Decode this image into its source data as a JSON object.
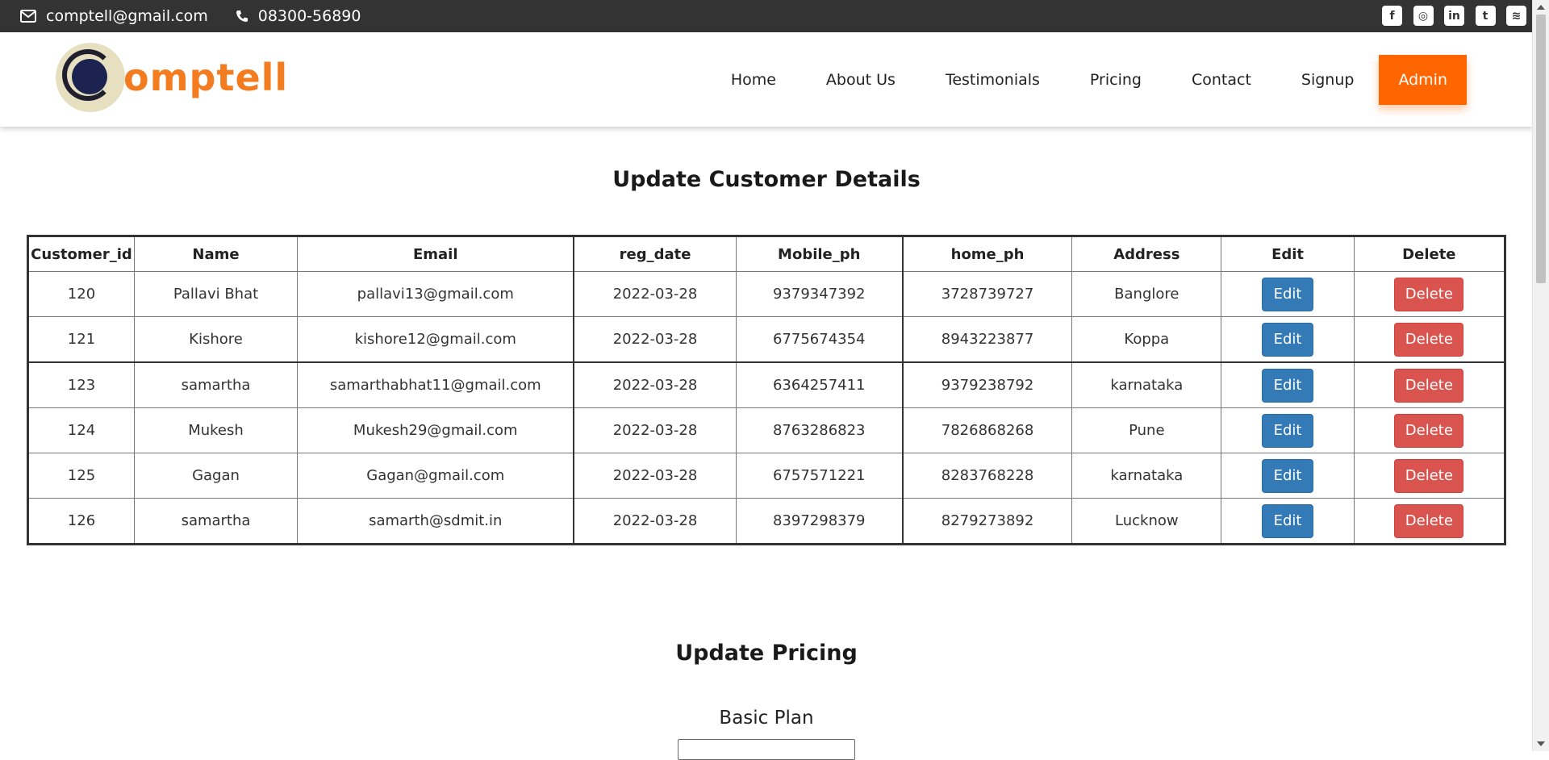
{
  "topbar": {
    "email": "comptell@gmail.com",
    "phone": "08300-56890",
    "email_icon": "envelope-icon",
    "phone_icon": "phone-icon",
    "social": [
      {
        "name": "facebook-icon",
        "glyph": "f"
      },
      {
        "name": "instagram-icon",
        "glyph": "◎"
      },
      {
        "name": "linkedin-icon",
        "glyph": "in"
      },
      {
        "name": "twitter-icon",
        "glyph": "t"
      },
      {
        "name": "rss-icon",
        "glyph": "≋"
      }
    ]
  },
  "brand": {
    "wordmark": "omptell",
    "emblem_text": "COMPTELL"
  },
  "nav": {
    "items": [
      "Home",
      "About Us",
      "Testimonials",
      "Pricing",
      "Contact",
      "Signup"
    ],
    "admin": "Admin"
  },
  "customers_section": {
    "title": "Update Customer Details",
    "columns": [
      "Customer_id",
      "Name",
      "Email",
      "reg_date",
      "Mobile_ph",
      "home_ph",
      "Address",
      "Edit",
      "Delete"
    ],
    "edit_label": "Edit",
    "delete_label": "Delete",
    "rows": [
      [
        "120",
        "Pallavi Bhat",
        "pallavi13@gmail.com",
        "2022-03-28",
        "9379347392",
        "3728739727",
        "Banglore"
      ],
      [
        "121",
        "Kishore",
        "kishore12@gmail.com",
        "2022-03-28",
        "6775674354",
        "8943223877",
        "Koppa"
      ],
      [
        "123",
        "samartha",
        "samarthabhat11@gmail.com",
        "2022-03-28",
        "6364257411",
        "9379238792",
        "karnataka"
      ],
      [
        "124",
        "Mukesh",
        "Mukesh29@gmail.com",
        "2022-03-28",
        "8763286823",
        "7826868268",
        "Pune"
      ],
      [
        "125",
        "Gagan",
        "Gagan@gmail.com",
        "2022-03-28",
        "6757571221",
        "8283768228",
        "karnataka"
      ],
      [
        "126",
        "samartha",
        "samarth@sdmit.in",
        "2022-03-28",
        "8397298379",
        "8279273892",
        "Lucknow"
      ]
    ]
  },
  "pricing_section": {
    "title": "Update Pricing",
    "plan_label": "Basic Plan",
    "plan_value": ""
  },
  "colors": {
    "topbar_bg": "#333333",
    "brand_orange": "#f47c20",
    "admin_bg": "#ff6600",
    "edit_btn": "#337ab7",
    "delete_btn": "#d9534f"
  }
}
